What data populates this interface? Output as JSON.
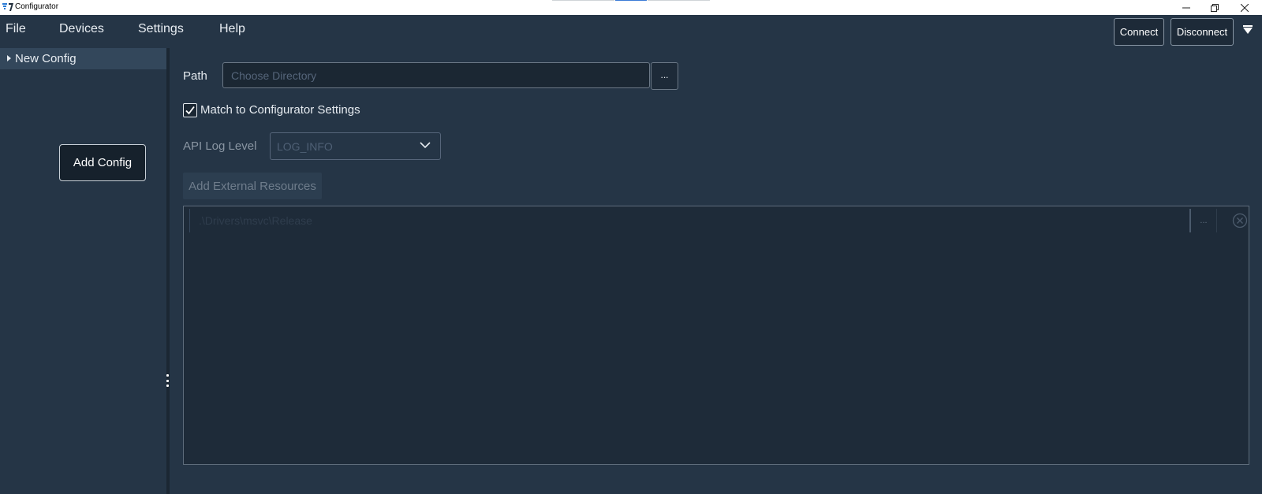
{
  "window": {
    "title": "Configurator",
    "controls": {
      "minimize": "minimize-icon",
      "maximize": "restore-icon",
      "close": "close-icon"
    }
  },
  "menu": {
    "items": [
      "File",
      "Devices",
      "Settings",
      "Help"
    ]
  },
  "toolbar": {
    "connect_label": "Connect",
    "disconnect_label": "Disconnect"
  },
  "sidebar": {
    "tree": [
      {
        "label": "New Config",
        "expanded": false
      }
    ],
    "add_config_label": "Add Config"
  },
  "form": {
    "path_label": "Path",
    "path_value": "",
    "path_placeholder": "Choose Directory",
    "browse_label": "...",
    "match_label": "Match to Configurator Settings",
    "match_checked": true,
    "log_level_label": "API Log Level",
    "log_level_value": "LOG_INFO",
    "ext_resources_label": "Add External Resources"
  },
  "resources": {
    "items": [
      {
        "path": ".\\Drivers\\msvc\\Release",
        "browse_label": "..."
      }
    ]
  },
  "colors": {
    "background": "#253546",
    "panel": "#1e2b39",
    "sidebar_selected": "#33475b",
    "text": "#e6ebf0",
    "disabled_text": "#6f7d8c"
  }
}
